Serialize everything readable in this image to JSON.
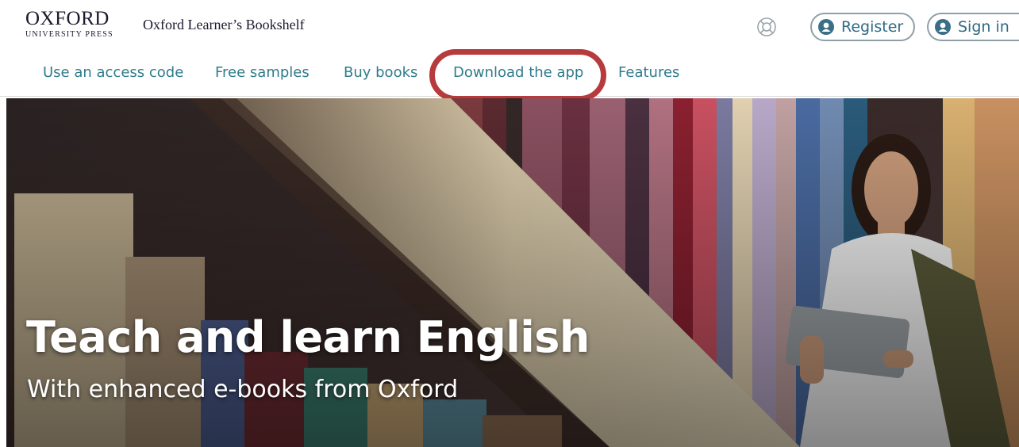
{
  "header": {
    "logo_main": "OXFORD",
    "logo_sub": "UNIVERSITY PRESS",
    "product_name": "Oxford Learner’s Bookshelf",
    "register_label": "Register",
    "signin_label": "Sign in",
    "help_icon": "lifebuoy-icon",
    "user_icon": "user-icon"
  },
  "nav": {
    "items": [
      {
        "label": "Use an access code"
      },
      {
        "label": "Free samples"
      },
      {
        "label": "Buy books"
      },
      {
        "label": "Download the app"
      },
      {
        "label": "Features"
      }
    ],
    "highlighted_item": "Download the app",
    "highlight_color": "#b73a3d",
    "link_color": "#2f7c8c"
  },
  "hero": {
    "title": "Teach and learn English",
    "subtitle": "With enhanced e-books from Oxford"
  }
}
